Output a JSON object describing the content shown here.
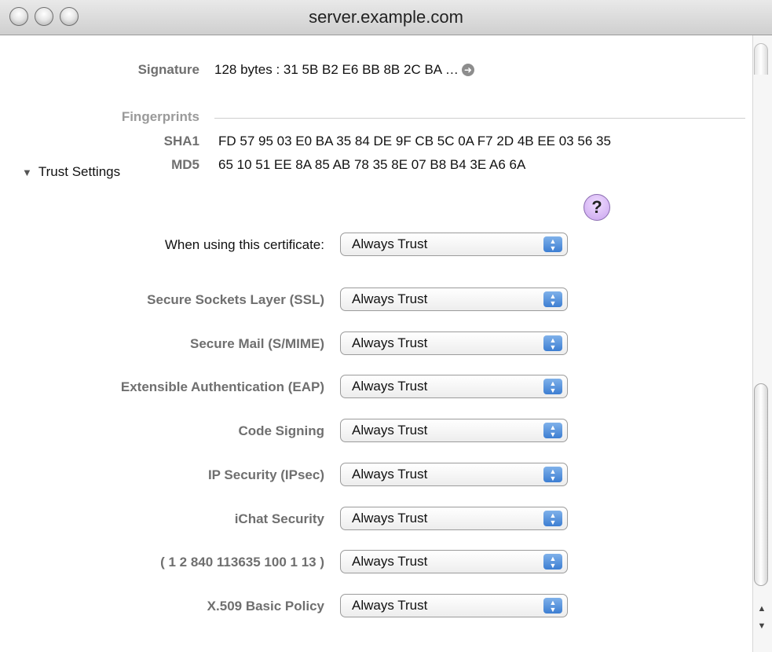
{
  "window": {
    "title": "server.example.com"
  },
  "certificate": {
    "signature_label": "Signature",
    "signature_value": "128 bytes : 31 5B B2 E6 BB 8B 2C BA …",
    "fingerprints_label": "Fingerprints",
    "sha1_label": "SHA1",
    "sha1_value": "FD 57 95 03 E0 BA 35 84 DE 9F CB 5C 0A F7 2D 4B EE 03 56 35",
    "md5_label": "MD5",
    "md5_value": "65 10 51 EE 8A 85 AB 78 35 8E 07 B8 B4 3E A6 6A"
  },
  "trust": {
    "section_label": "Trust Settings",
    "when_using_label": "When using this certificate:",
    "when_using_value": "Always Trust",
    "help_label": "?",
    "rows": [
      {
        "label": "Secure Sockets Layer (SSL)",
        "value": "Always Trust"
      },
      {
        "label": "Secure Mail (S/MIME)",
        "value": "Always Trust"
      },
      {
        "label": "Extensible Authentication (EAP)",
        "value": "Always Trust"
      },
      {
        "label": "Code Signing",
        "value": "Always Trust"
      },
      {
        "label": "IP Security (IPsec)",
        "value": "Always Trust"
      },
      {
        "label": "iChat Security",
        "value": "Always Trust"
      },
      {
        "label": "( 1 2 840 113635 100 1 13 )",
        "value": "Always Trust"
      },
      {
        "label": "X.509 Basic Policy",
        "value": "Always Trust"
      }
    ]
  },
  "icons": {
    "close": "close-icon",
    "minimize": "minimize-icon",
    "zoom": "zoom-icon",
    "disclosure": "disclosure-triangle-icon",
    "arrow": "arrow-right-icon",
    "stepper": "stepper-icon"
  },
  "colors": {
    "help_bg": "#d8b8f5",
    "stepper_blue": "#3d7ed2"
  }
}
